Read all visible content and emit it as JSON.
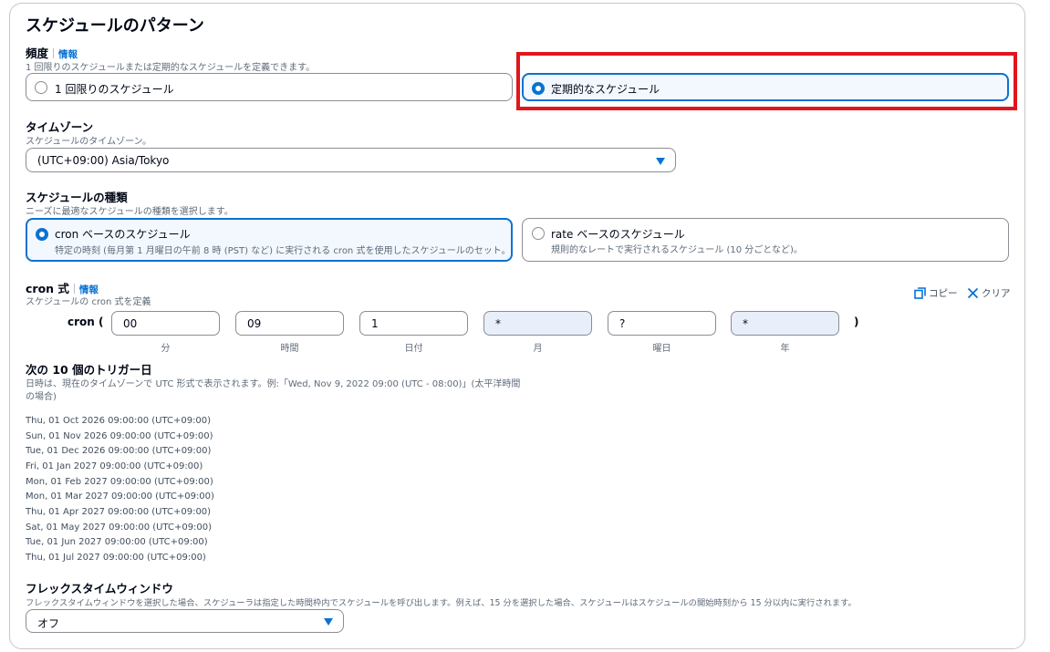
{
  "title": "スケジュールのパターン",
  "frequency": {
    "label": "頻度",
    "info": "情報",
    "description": "1 回限りのスケジュールまたは定期的なスケジュールを定義できます。",
    "options": [
      {
        "label": "1 回限りのスケジュール",
        "selected": false
      },
      {
        "label": "定期的なスケジュール",
        "selected": true
      }
    ]
  },
  "timezone": {
    "label": "タイムゾーン",
    "description": "スケジュールのタイムゾーン。",
    "value": "(UTC+09:00) Asia/Tokyo"
  },
  "schedule_type": {
    "label": "スケジュールの種類",
    "description": "ニーズに最適なスケジュールの種類を選択します。",
    "options": [
      {
        "label": "cron ベースのスケジュール",
        "sub": "特定の時刻 (毎月第 1 月曜日の午前 8 時 (PST) など) に実行される cron 式を使用したスケジュールのセット。",
        "selected": true
      },
      {
        "label": "rate ベースのスケジュール",
        "sub": "規則的なレートで実行されるスケジュール (10 分ごとなど)。",
        "selected": false
      }
    ]
  },
  "cron": {
    "label": "cron 式",
    "info": "情報",
    "description": "スケジュールの cron 式を定義",
    "copy": "コピー",
    "clear": "クリア",
    "open": "cron (",
    "close": ")",
    "fields": [
      {
        "value": "00",
        "caption": "分"
      },
      {
        "value": "09",
        "caption": "時間"
      },
      {
        "value": "1",
        "caption": "日付"
      },
      {
        "value": "*",
        "caption": "月"
      },
      {
        "value": "?",
        "caption": "曜日"
      },
      {
        "value": "*",
        "caption": "年"
      }
    ]
  },
  "triggers": {
    "label": "次の 10 個のトリガー日",
    "description_line1": "日時は、現在のタイムゾーンで UTC 形式で表示されます。例:「Wed, Nov 9, 2022 09:00 (UTC - 08:00)」(太平洋時間",
    "description_line2": "の場合)",
    "dates": [
      "Thu, 01 Oct 2026 09:00:00 (UTC+09:00)",
      "Sun, 01 Nov 2026 09:00:00 (UTC+09:00)",
      "Tue, 01 Dec 2026 09:00:00 (UTC+09:00)",
      "Fri, 01 Jan 2027 09:00:00 (UTC+09:00)",
      "Mon, 01 Feb 2027 09:00:00 (UTC+09:00)",
      "Mon, 01 Mar 2027 09:00:00 (UTC+09:00)",
      "Thu, 01 Apr 2027 09:00:00 (UTC+09:00)",
      "Sat, 01 May 2027 09:00:00 (UTC+09:00)",
      "Tue, 01 Jun 2027 09:00:00 (UTC+09:00)",
      "Thu, 01 Jul 2027 09:00:00 (UTC+09:00)"
    ]
  },
  "flex": {
    "label": "フレックスタイムウィンドウ",
    "description": "フレックスタイムウィンドウを選択した場合、スケジューラは指定した時間枠内でスケジュールを呼び出します。例えば、15 分を選択した場合、スケジュールはスケジュールの開始時刻から 15 分以内に実行されます。",
    "value": "オフ"
  },
  "colors": {
    "accent": "#0972d3",
    "highlight": "#e0161c"
  }
}
